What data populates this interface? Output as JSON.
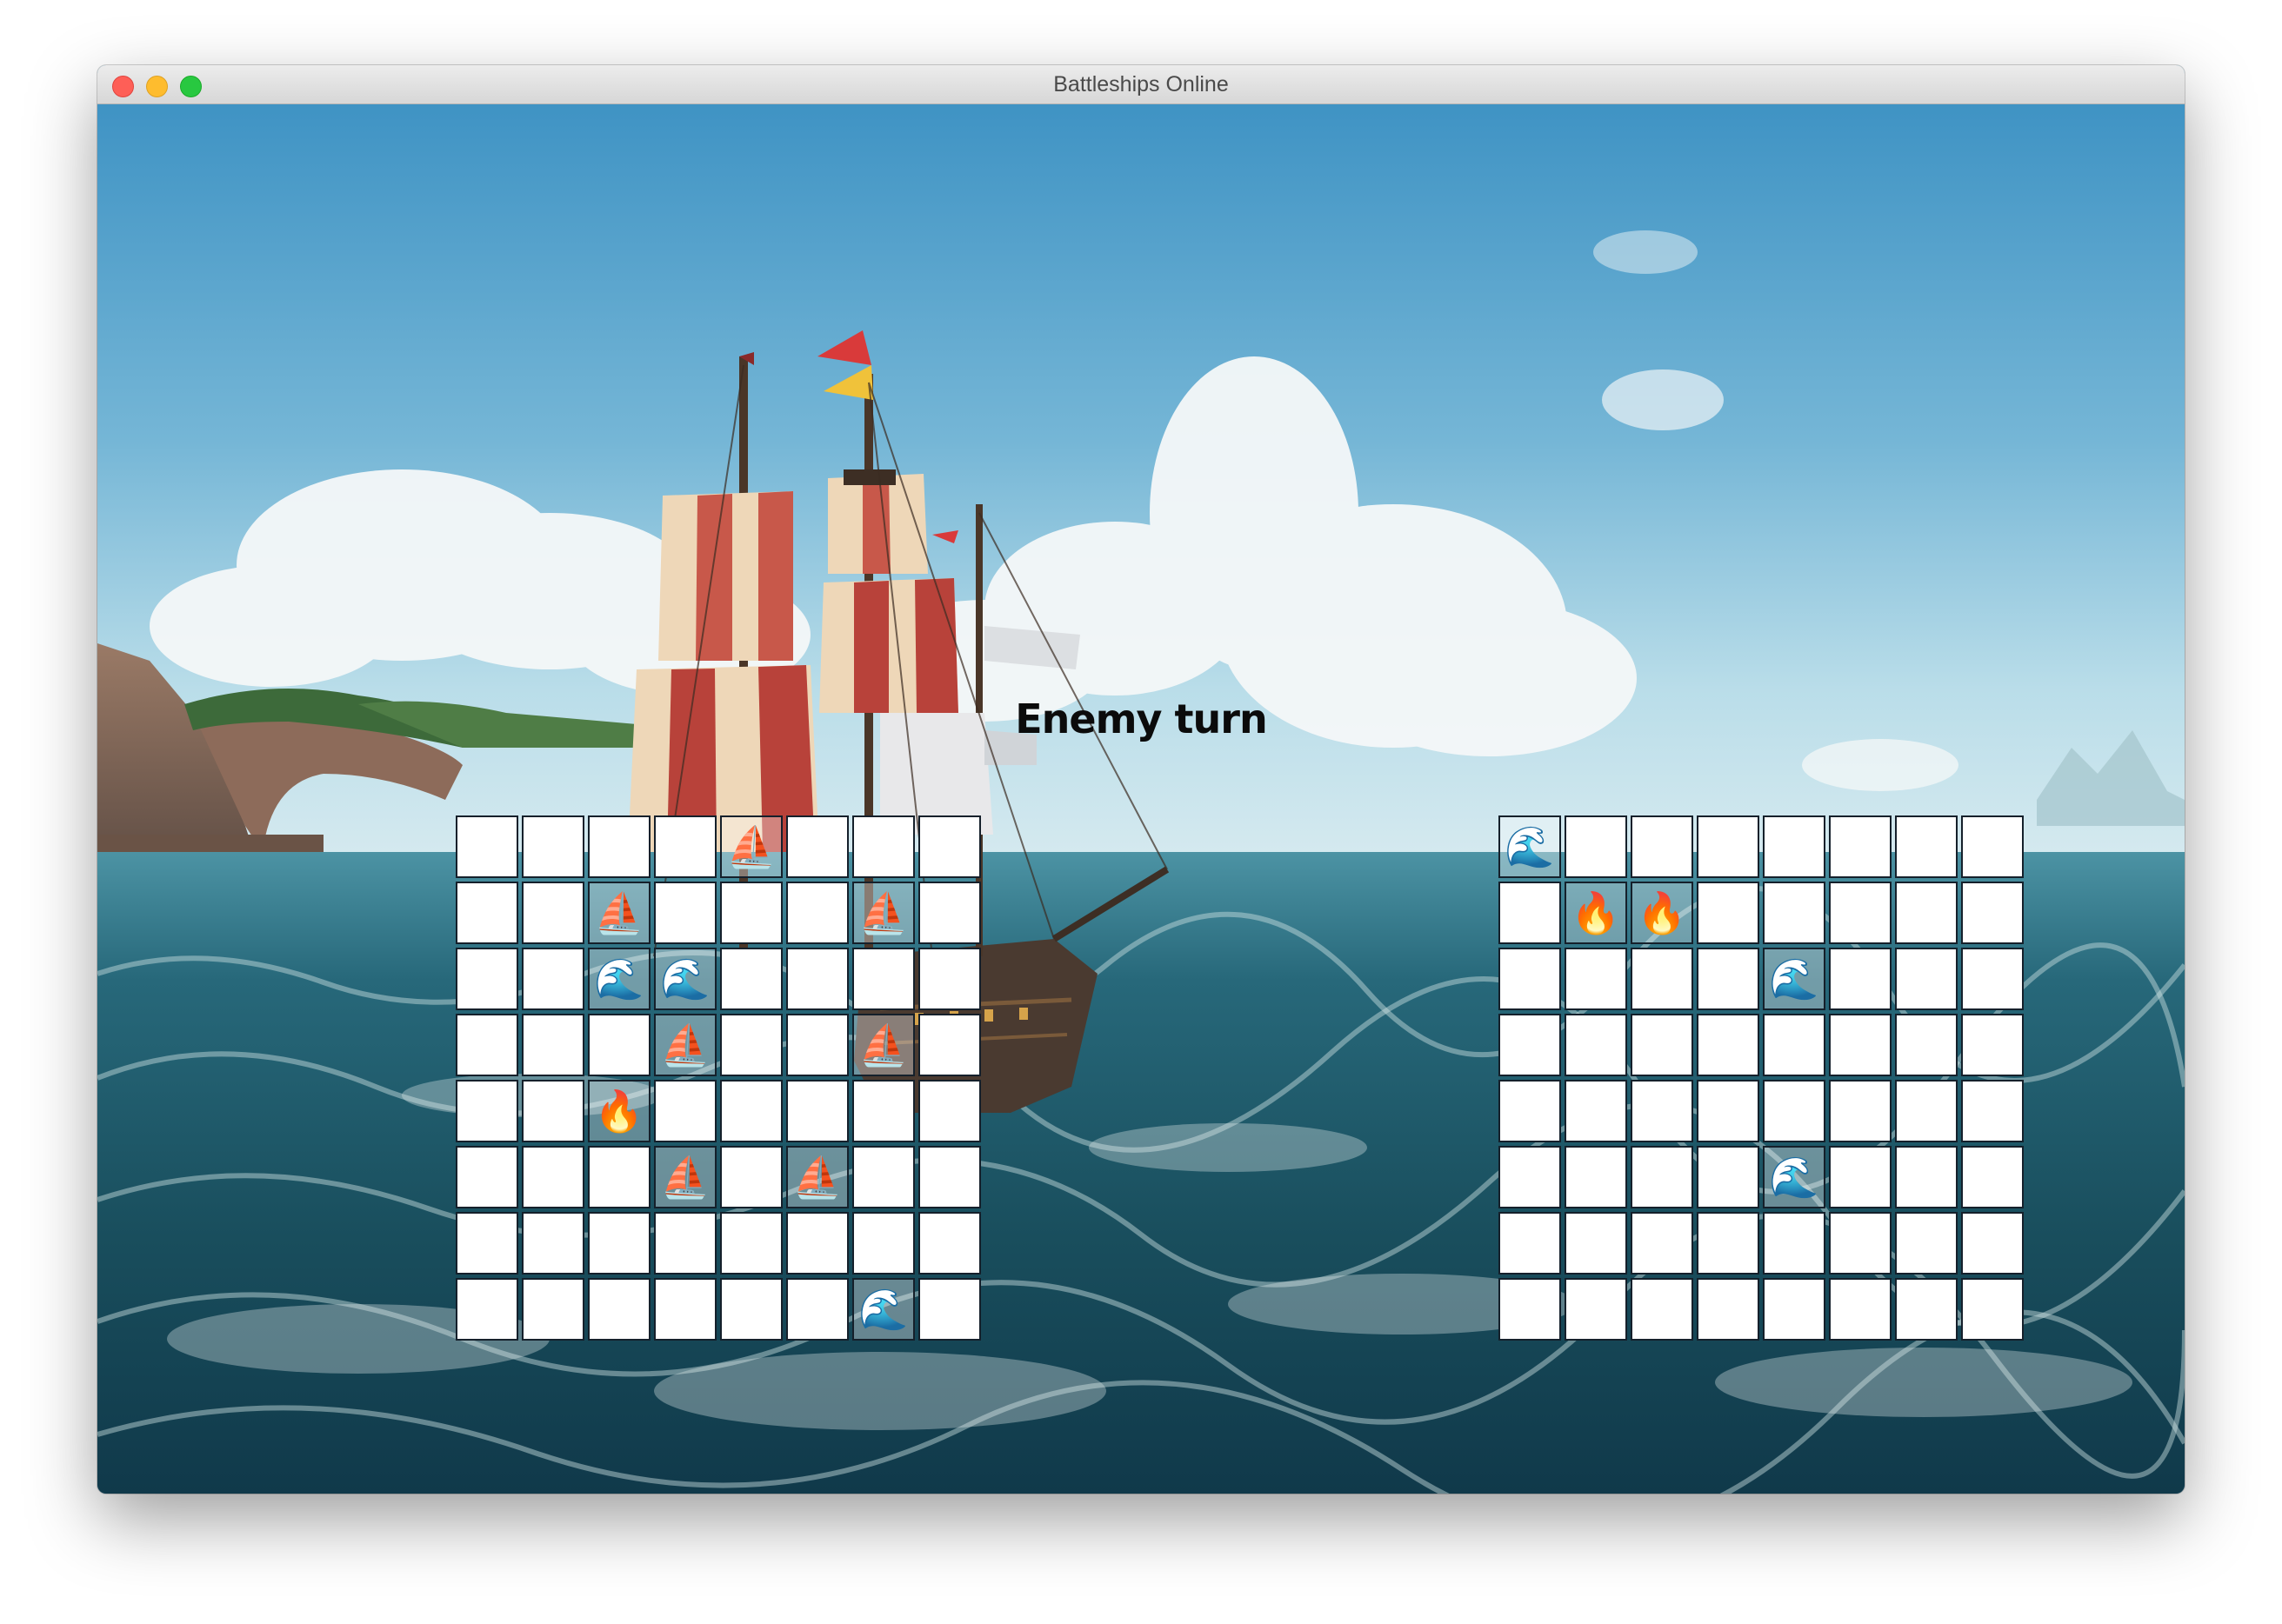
{
  "window": {
    "title": "Battleships Online",
    "buttons": [
      "close",
      "minimize",
      "zoom"
    ]
  },
  "status": {
    "text": "Enemy turn"
  },
  "legend": {
    "ship": {
      "icon": "sailboat-icon",
      "glyph": "⛵"
    },
    "miss": {
      "icon": "wave-icon",
      "glyph": "🌊"
    },
    "hit": {
      "icon": "fire-icon",
      "glyph": "🔥"
    }
  },
  "boards": {
    "player": {
      "size": 8,
      "rows": [
        [
          "",
          "",
          "",
          "",
          "ship",
          "",
          "",
          ""
        ],
        [
          "",
          "",
          "ship",
          "",
          "",
          "",
          "ship",
          ""
        ],
        [
          "",
          "",
          "miss",
          "miss",
          "",
          "",
          "",
          ""
        ],
        [
          "",
          "",
          "",
          "ship",
          "",
          "",
          "ship",
          ""
        ],
        [
          "",
          "",
          "hit",
          "",
          "",
          "",
          "",
          ""
        ],
        [
          "",
          "",
          "",
          "ship",
          "",
          "ship",
          "",
          ""
        ],
        [
          "",
          "",
          "",
          "",
          "",
          "",
          "",
          ""
        ],
        [
          "",
          "",
          "",
          "",
          "",
          "",
          "miss",
          ""
        ]
      ]
    },
    "enemy": {
      "size": 8,
      "rows": [
        [
          "miss",
          "",
          "",
          "",
          "",
          "",
          "",
          ""
        ],
        [
          "",
          "hit",
          "hit",
          "",
          "",
          "",
          "",
          ""
        ],
        [
          "",
          "",
          "",
          "",
          "miss",
          "",
          "",
          ""
        ],
        [
          "",
          "",
          "",
          "",
          "",
          "",
          "",
          ""
        ],
        [
          "",
          "",
          "",
          "",
          "",
          "",
          "",
          ""
        ],
        [
          "",
          "",
          "",
          "",
          "miss",
          "",
          "",
          ""
        ],
        [
          "",
          "",
          "",
          "",
          "",
          "",
          "",
          ""
        ],
        [
          "",
          "",
          "",
          "",
          "",
          "",
          "",
          ""
        ]
      ]
    }
  },
  "colors": {
    "sky_top": "#3d93c4",
    "sky_mid": "#8fc7de",
    "sea": "#1c5566",
    "sea_deep": "#0e3340",
    "cloud": "#f3f6f7",
    "sail_stripe_red": "#b8423a",
    "sail_stripe_light": "#f0dcc0",
    "hull": "#4a3a30",
    "cell_border": "#15202b"
  }
}
